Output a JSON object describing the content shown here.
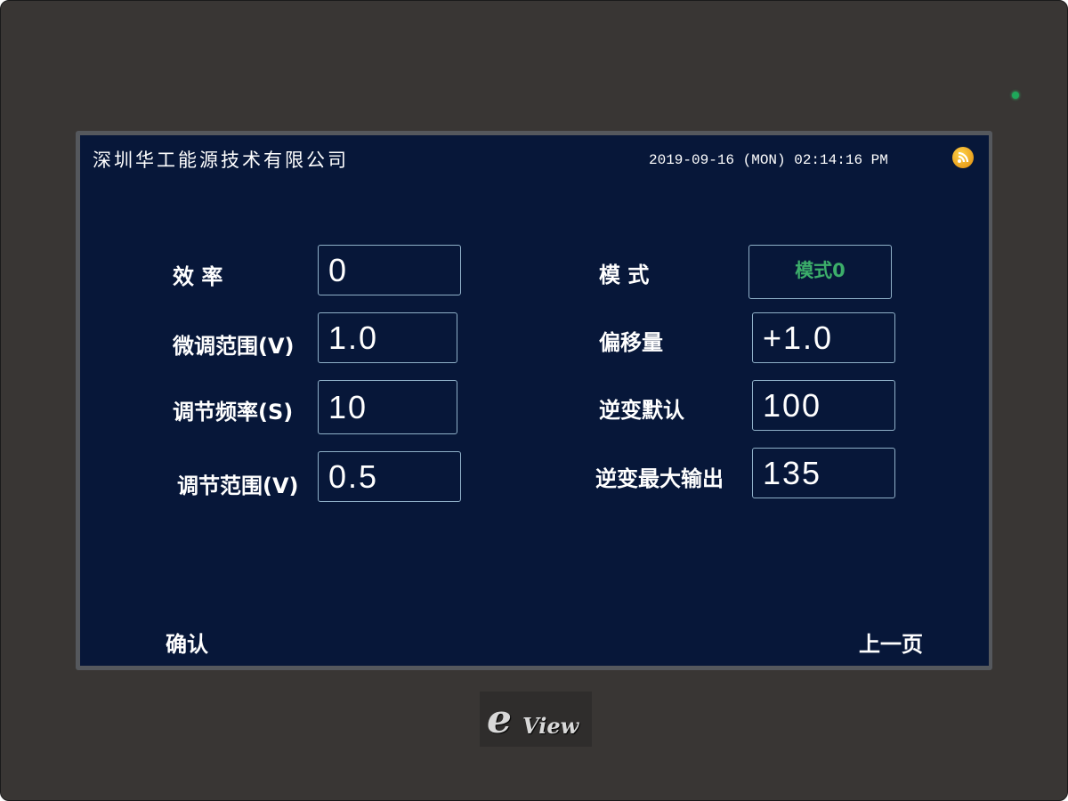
{
  "header": {
    "company": "深圳华工能源技术有限公司",
    "datetime": "2019-09-16 (MON) 02:14:16 PM",
    "status_icon": "rss-icon"
  },
  "left_fields": [
    {
      "label": "效  率",
      "value": "0"
    },
    {
      "label": "微调范围(V)",
      "value": "1.0"
    },
    {
      "label": "调节频率(S)",
      "value": "10"
    },
    {
      "label": "调节范围(V)",
      "value": "0.5"
    }
  ],
  "right_fields": [
    {
      "label": "模  式",
      "value": "模式0"
    },
    {
      "label": "偏移量",
      "value": "+1.0"
    },
    {
      "label": "逆变默认",
      "value": "100"
    },
    {
      "label": "逆变最大输出",
      "value": "135"
    }
  ],
  "footer": {
    "confirm_label": "确认",
    "prev_label": "上一页"
  },
  "brand": {
    "e": "e",
    "view": "View"
  },
  "colors": {
    "screen_bg": "#071739",
    "bezel": "#393634",
    "mode_text": "#3cae6a",
    "field_border": "#8fb0c8",
    "led": "#1fa85a"
  }
}
